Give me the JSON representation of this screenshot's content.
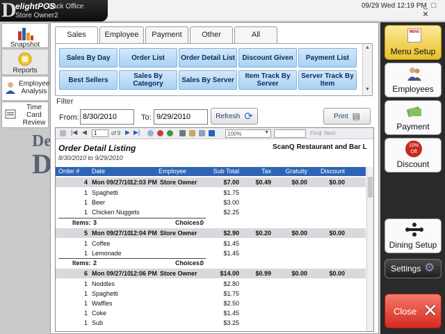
{
  "app": {
    "brand": "elightPOS",
    "brand_initial": "D",
    "section": "-Back Office",
    "user": "Store Owner2",
    "clock": "09/29 Wed 12:19 PM",
    "window_controls": [
      "_",
      "□",
      "✕"
    ]
  },
  "left_nav": [
    {
      "label": "Snapshot",
      "icon": "bar-chart-icon"
    },
    {
      "label": "Reports",
      "icon": "reports-icon"
    },
    {
      "label": "Employee Analysis",
      "icon": "employee-analysis-icon"
    },
    {
      "label": "Time Card Review",
      "icon": "time-card-icon"
    }
  ],
  "tabs": [
    "Sales",
    "Employee",
    "Payment",
    "Other",
    "All"
  ],
  "selected_tab": "Sales",
  "report_buttons": [
    [
      "Sales By Day",
      "Order List",
      "Order Detail List",
      "Discount Given",
      "Payment List"
    ],
    [
      "Best Sellers",
      "Sales By Category",
      "Sales By Server",
      "Item Track By Server",
      "Server Track By Item"
    ]
  ],
  "filter": {
    "legend": "Filter",
    "from_label": "From:",
    "from_value": "8/30/2010",
    "to_label": "To:",
    "to_value": "9/29/2010",
    "refresh_label": "Refresh",
    "print_label": "Print"
  },
  "viewer_toolbar": {
    "page": "1",
    "of_pages": "of 9",
    "zoom": "100%",
    "find_label": "Find",
    "next_label": "Next"
  },
  "report": {
    "title": "Order Detail Listing",
    "company": "ScanQ Restaurant and Bar L",
    "range": "8/30/2010 to 9/29/2010",
    "columns": [
      "Order #",
      "Date",
      "Employee",
      "Sub Total",
      "Tax",
      "Gratuity",
      "Discount"
    ],
    "orders": [
      {
        "num": "4",
        "date": "Mon 09/27/10",
        "time": "12:03 PM",
        "employee": "Store Owner",
        "subtotal": "$7.00",
        "tax": "$0.49",
        "gratuity": "$0.00",
        "discount": "$0.00",
        "items": [
          {
            "qty": "1",
            "name": "Spaghetti",
            "price": "$1.75"
          },
          {
            "qty": "1",
            "name": "Beer",
            "price": "$3.00"
          },
          {
            "qty": "1",
            "name": "Chicken Nuggets",
            "price": "$2.25"
          }
        ],
        "items_label": "Items:",
        "items_count": "3",
        "choices_label": "Choices:",
        "choices_count": "0"
      },
      {
        "num": "5",
        "date": "Mon 09/27/10",
        "time": "12:04 PM",
        "employee": "Store Owner",
        "subtotal": "$2.90",
        "tax": "$0.20",
        "gratuity": "$0.00",
        "discount": "$0.00",
        "items": [
          {
            "qty": "1",
            "name": "Coffee",
            "price": "$1.45"
          },
          {
            "qty": "1",
            "name": "Lemonade",
            "price": "$1.45"
          }
        ],
        "items_label": "Items:",
        "items_count": "2",
        "choices_label": "Choices:",
        "choices_count": "0"
      },
      {
        "num": "6",
        "date": "Mon 09/27/10",
        "time": "12:06 PM",
        "employee": "Store Owner",
        "subtotal": "$14.00",
        "tax": "$0.99",
        "gratuity": "$0.00",
        "discount": "$0.00",
        "items": [
          {
            "qty": "1",
            "name": "Noddles",
            "price": "$2.80"
          },
          {
            "qty": "1",
            "name": "Spaghetti",
            "price": "$1.75"
          },
          {
            "qty": "1",
            "name": "Waffles",
            "price": "$2.50"
          },
          {
            "qty": "1",
            "name": "Coke",
            "price": "$1.45"
          },
          {
            "qty": "1",
            "name": "Sub",
            "price": "$3.25"
          }
        ]
      }
    ]
  },
  "right_nav": {
    "menu_setup": "Menu Setup",
    "menu_badge": "MENU",
    "employees": "Employees",
    "payment": "Payment",
    "discount": "Discount",
    "discount_badge_top": "10%",
    "discount_badge_bottom": "Off",
    "dining_setup": "Dining Setup",
    "settings": "Settings",
    "close": "Close"
  },
  "colors": {
    "accent_blue": "#2e64b5",
    "report_button": "#a9d1f4",
    "menu_setup": "#e9c126",
    "close": "#d42a1f",
    "order_row": "#d7d9dc"
  }
}
